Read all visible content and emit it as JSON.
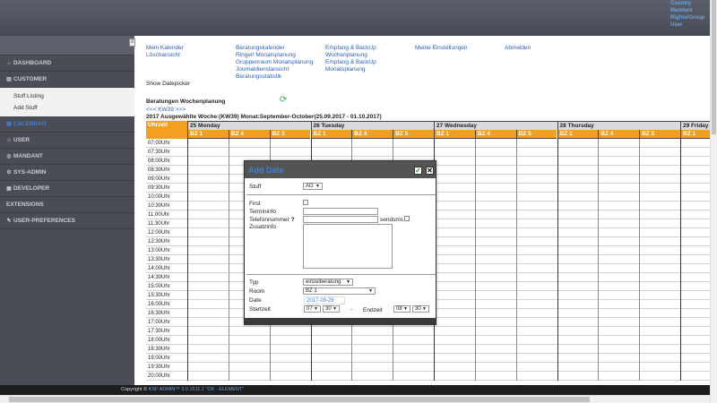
{
  "header": {
    "links": [
      "Country",
      "Mandant",
      "Rights/Group",
      "User"
    ]
  },
  "sidebar": {
    "toggle_icon": "collapse-icon",
    "sections_top": [
      {
        "label": "Dashboard",
        "icon": "home-icon"
      },
      {
        "label": "CUSTOMER",
        "icon": "customer-icon"
      }
    ],
    "sub_items": [
      "Stuff Listing",
      "Add Stuff"
    ],
    "sections_bottom": [
      {
        "label": "CALENDAR",
        "icon": "calendar-icon",
        "active": true
      },
      {
        "label": "USER",
        "icon": "user-icon"
      },
      {
        "label": "MANDANT",
        "icon": "mandant-icon"
      },
      {
        "label": "SYS-ADMIN",
        "icon": "sysadmin-icon"
      },
      {
        "label": "DEVELOPER",
        "icon": "developer-icon"
      },
      {
        "label": "EXTENSIONS",
        "icon": ""
      },
      {
        "label": "USER-PREFERENCES",
        "icon": "preferences-icon"
      }
    ]
  },
  "nav": {
    "col1": [
      "Mein Kalender",
      "Löschansicht"
    ],
    "col2": [
      "Beratungskalender",
      "Ringerl Monatsplanung",
      "Gruppenraum Monatsplanung",
      "Journaldienstansicht",
      "Beratungsstatistik"
    ],
    "col3": [
      "Empfang & BackUp",
      "Wochenplanung",
      "Empfang & BackUp",
      "Monatsplanung"
    ],
    "col4": [
      "Meine Einstellungen"
    ],
    "col5": [
      "Abmelden"
    ]
  },
  "main": {
    "show_datepicker": "Show Datepicker",
    "plan_title": "Beratungen Wochenplanung",
    "kw_nav": "<<< KW39 >>>",
    "week_info": "2017 Ausgewählte Woche:(KW39) Monat:September-October(25.09.2017 - 01.10.2017)"
  },
  "grid": {
    "time_header": "Uhrzeit",
    "days": [
      "25 Monday",
      "26 Tuesday",
      "27 Wednesday",
      "28 Thursday",
      "29 Friday"
    ],
    "rooms": [
      "BZ 1",
      "BZ 4",
      "BZ 5"
    ],
    "times": [
      "07:00Uhr",
      "07:30Uhr",
      "08:00Uhr",
      "08:30Uhr",
      "09:00Uhr",
      "09:30Uhr",
      "10:00Uhr",
      "10:30Uhr",
      "11:00Uhr",
      "11:30Uhr",
      "12:00Uhr",
      "12:30Uhr",
      "13:00Uhr",
      "13:30Uhr",
      "14:00Uhr",
      "14:30Uhr",
      "15:00Uhr",
      "15:30Uhr",
      "16:00Uhr",
      "16:30Uhr",
      "17:00Uhr",
      "17:30Uhr",
      "18:00Uhr",
      "18:30Uhr",
      "19:00Uhr",
      "19:30Uhr",
      "20:00Uhr"
    ]
  },
  "dialog": {
    "title": "Add Date",
    "ok_icon": "check-icon",
    "close_icon": "close-icon",
    "stuff_label": "Stuff",
    "stuff_value": "AG",
    "first_label": "First",
    "termininfo_label": "Termininfo",
    "telefon_label": "Telefonnummer",
    "help_mark": "?",
    "sendsms_label": "sendsms",
    "zusatzinfo_label": "Zusatzinfo",
    "typ_label": "Typ",
    "typ_value": "einzelberatung",
    "room_label": "Room",
    "room_value": "BZ 1",
    "date_label": "Date",
    "date_value": "2017-09-26",
    "startzeit_label": "Startzeit",
    "start_hour": "07",
    "start_min": "30",
    "dash": "-",
    "endzeit_label": "Endzeit",
    "end_hour": "08",
    "end_min": "30"
  },
  "footer": {
    "copyright": "Copyright ©",
    "product": "KSF ADMIN™ 3.0.1511.1 \"OK - ELEMENT\""
  }
}
